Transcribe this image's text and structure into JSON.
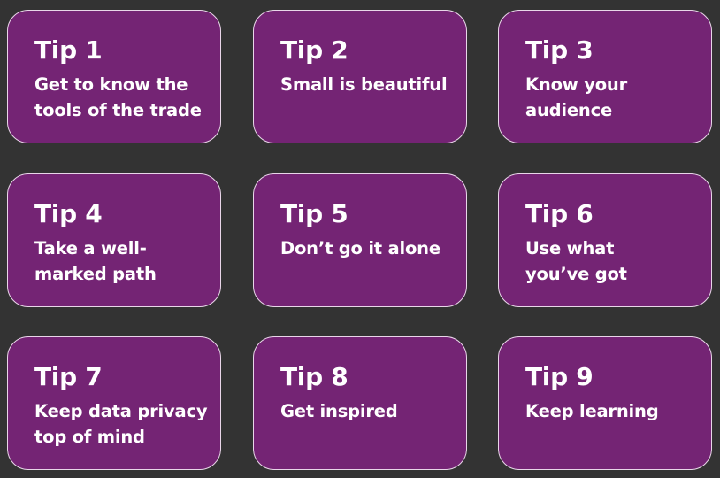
{
  "tips": [
    {
      "title": "Tip 1",
      "text": "Get to know the\ntools of the trade"
    },
    {
      "title": "Tip 2",
      "text": "Small is beautiful"
    },
    {
      "title": "Tip 3",
      "text": "Know your\naudience"
    },
    {
      "title": "Tip 4",
      "text": "Take a well-\nmarked path"
    },
    {
      "title": "Tip 5",
      "text": "Don’t go it alone"
    },
    {
      "title": "Tip 6",
      "text": "Use what\nyou’ve got"
    },
    {
      "title": "Tip 7",
      "text": "Keep data privacy\ntop of mind"
    },
    {
      "title": "Tip 8",
      "text": "Get inspired"
    },
    {
      "title": "Tip 9",
      "text": "Keep learning"
    }
  ],
  "colors": {
    "background": "#333333",
    "card": "#742474",
    "card_border": "#e9d6e9",
    "text": "#ffffff"
  }
}
